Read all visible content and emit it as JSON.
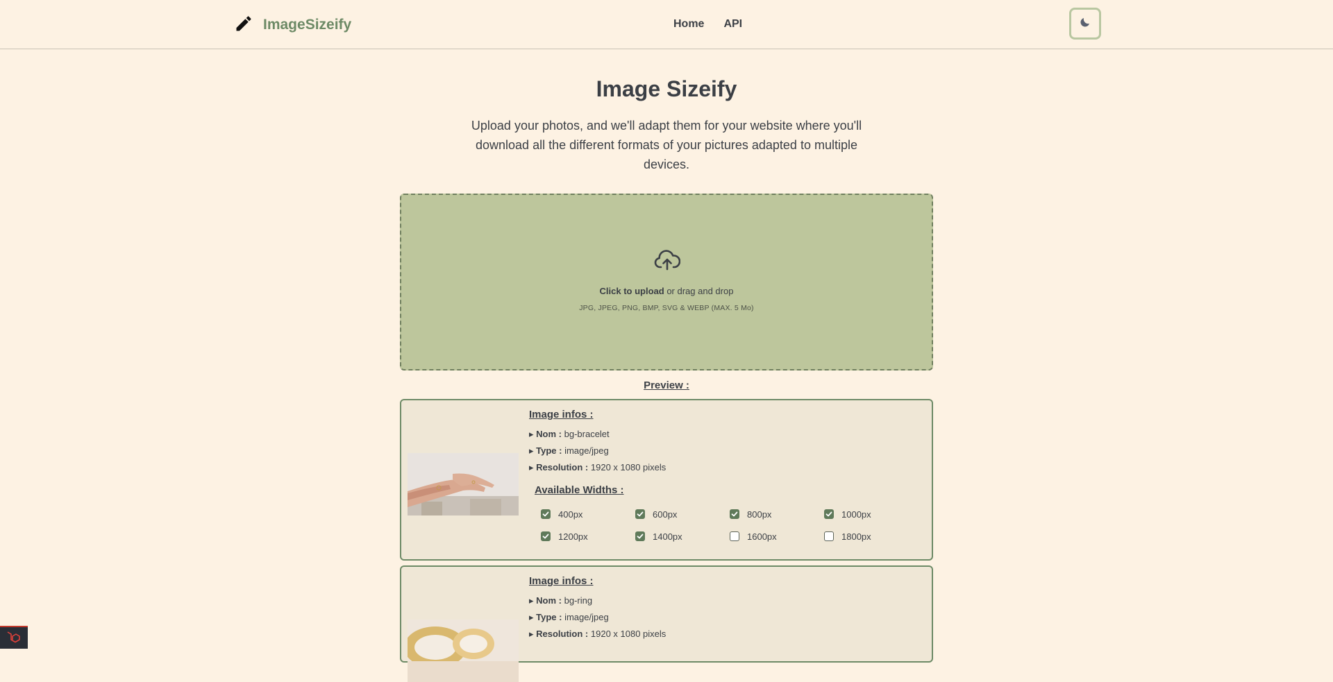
{
  "header": {
    "brand": "ImageSizeify",
    "nav": [
      {
        "label": "Home"
      },
      {
        "label": "API"
      }
    ],
    "theme_icon": "moon-icon"
  },
  "hero": {
    "title": "Image Sizeify",
    "subtitle": "Upload your photos, and we'll adapt them for your website where you'll download all the different formats of your pictures adapted to multiple devices."
  },
  "upload": {
    "icon": "cloud-upload-icon",
    "cta_bold": "Click to upload",
    "cta_rest": " or drag and drop",
    "formats": "JPG, JPEG, PNG, BMP, SVG & WEBP (MAX. 5 Mo)"
  },
  "preview": {
    "label": "Preview :",
    "info_title": "Image infos :",
    "labels": {
      "name": "Nom :",
      "type": "Type :",
      "resolution": "Resolution :"
    },
    "widths_title": "Available Widths :",
    "images": [
      {
        "name": "bg-bracelet",
        "type": "image/jpeg",
        "resolution": "1920 x 1080 pixels",
        "widths": [
          {
            "label": "400px",
            "checked": true
          },
          {
            "label": "600px",
            "checked": true
          },
          {
            "label": "800px",
            "checked": true
          },
          {
            "label": "1000px",
            "checked": true
          },
          {
            "label": "1200px",
            "checked": true
          },
          {
            "label": "1400px",
            "checked": true
          },
          {
            "label": "1600px",
            "checked": false
          },
          {
            "label": "1800px",
            "checked": false
          }
        ]
      },
      {
        "name": "bg-ring",
        "type": "image/jpeg",
        "resolution": "1920 x 1080 pixels"
      }
    ]
  },
  "colors": {
    "background": "#fdf2e3",
    "accent": "#6d8a66",
    "dropzone": "#bdc69c",
    "card": "#efe7d6"
  }
}
